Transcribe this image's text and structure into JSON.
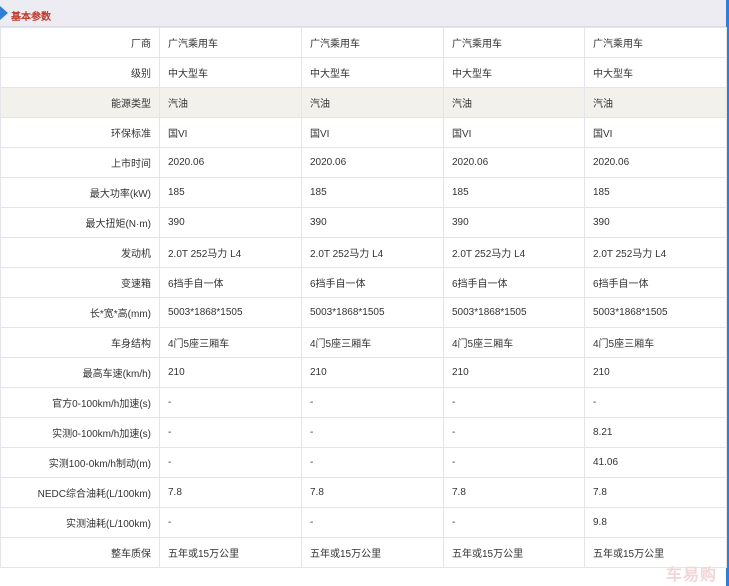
{
  "section": {
    "title": "基本参数"
  },
  "watermark": "车易购",
  "rows": [
    {
      "label": "厂商",
      "values": [
        "广汽乘用车",
        "广汽乘用车",
        "广汽乘用车",
        "广汽乘用车"
      ]
    },
    {
      "label": "级别",
      "values": [
        "中大型车",
        "中大型车",
        "中大型车",
        "中大型车"
      ]
    },
    {
      "label": "能源类型",
      "values": [
        "汽油",
        "汽油",
        "汽油",
        "汽油"
      ]
    },
    {
      "label": "环保标准",
      "values": [
        "国VI",
        "国VI",
        "国VI",
        "国VI"
      ]
    },
    {
      "label": "上市时间",
      "values": [
        "2020.06",
        "2020.06",
        "2020.06",
        "2020.06"
      ]
    },
    {
      "label": "最大功率(kW)",
      "values": [
        "185",
        "185",
        "185",
        "185"
      ]
    },
    {
      "label": "最大扭矩(N·m)",
      "values": [
        "390",
        "390",
        "390",
        "390"
      ]
    },
    {
      "label": "发动机",
      "values": [
        "2.0T 252马力 L4",
        "2.0T 252马力 L4",
        "2.0T 252马力 L4",
        "2.0T 252马力 L4"
      ]
    },
    {
      "label": "变速箱",
      "values": [
        "6挡手自一体",
        "6挡手自一体",
        "6挡手自一体",
        "6挡手自一体"
      ]
    },
    {
      "label": "长*宽*高(mm)",
      "values": [
        "5003*1868*1505",
        "5003*1868*1505",
        "5003*1868*1505",
        "5003*1868*1505"
      ]
    },
    {
      "label": "车身结构",
      "values": [
        "4门5座三厢车",
        "4门5座三厢车",
        "4门5座三厢车",
        "4门5座三厢车"
      ]
    },
    {
      "label": "最高车速(km/h)",
      "values": [
        "210",
        "210",
        "210",
        "210"
      ]
    },
    {
      "label": "官方0-100km/h加速(s)",
      "values": [
        "-",
        "-",
        "-",
        "-"
      ]
    },
    {
      "label": "实测0-100km/h加速(s)",
      "values": [
        "-",
        "-",
        "-",
        "8.21"
      ]
    },
    {
      "label": "实测100-0km/h制动(m)",
      "values": [
        "-",
        "-",
        "-",
        "41.06"
      ]
    },
    {
      "label": "NEDC综合油耗(L/100km)",
      "values": [
        "7.8",
        "7.8",
        "7.8",
        "7.8"
      ]
    },
    {
      "label": "实测油耗(L/100km)",
      "values": [
        "-",
        "-",
        "-",
        "9.8"
      ]
    },
    {
      "label": "整车质保",
      "values": [
        "五年或15万公里",
        "五年或15万公里",
        "五年或15万公里",
        "五年或15万公里"
      ]
    }
  ]
}
